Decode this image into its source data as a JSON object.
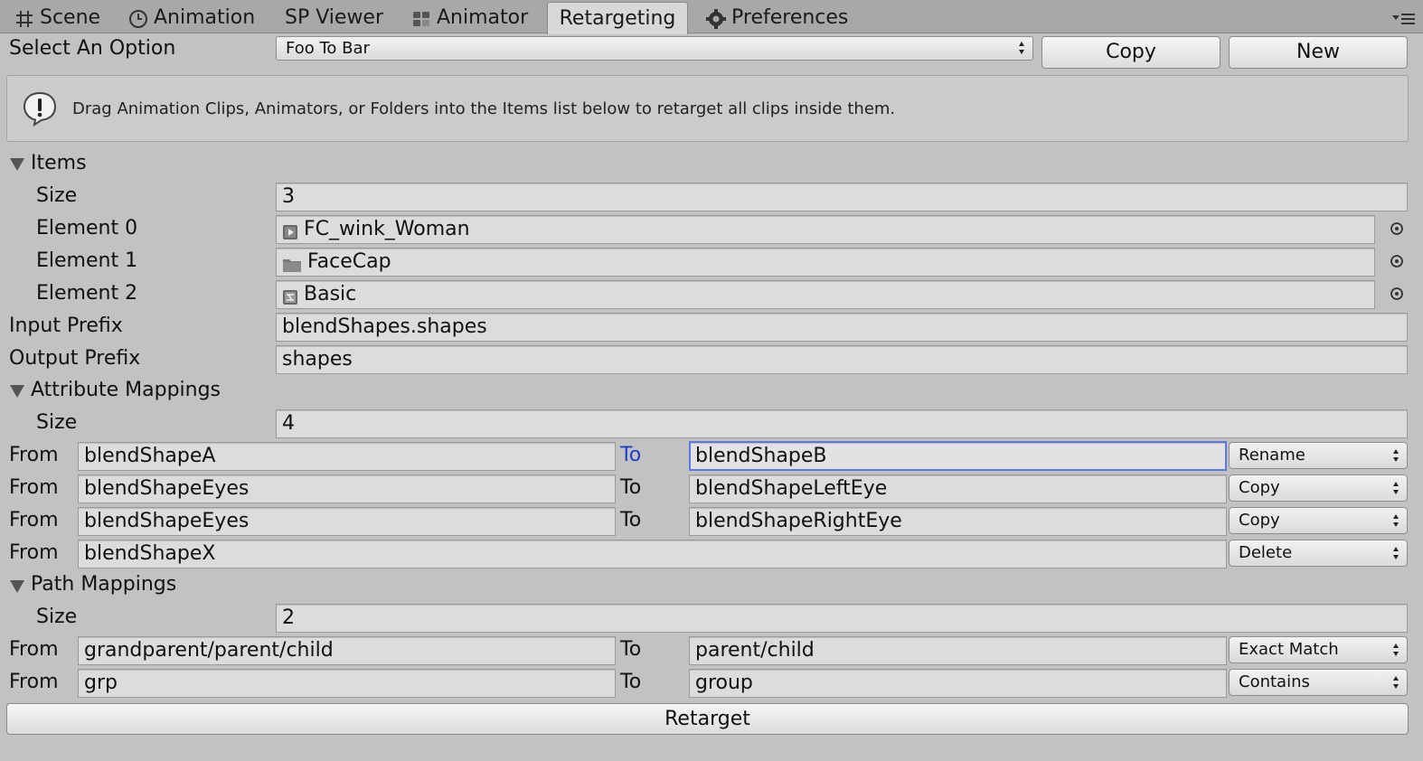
{
  "tabs": [
    {
      "label": "Scene",
      "icon": "grid-icon"
    },
    {
      "label": "Animation",
      "icon": "clock-icon"
    },
    {
      "label": "SP Viewer",
      "icon": ""
    },
    {
      "label": "Animator",
      "icon": "animator-icon"
    },
    {
      "label": "Retargeting",
      "icon": "",
      "active": true
    },
    {
      "label": "Preferences",
      "icon": "gear-icon"
    }
  ],
  "select": {
    "label": "Select An Option",
    "value": "Foo To Bar",
    "copy_label": "Copy",
    "new_label": "New"
  },
  "help": {
    "icon": "info-icon",
    "text": "Drag Animation Clips, Animators, or Folders into the Items list below to retarget all clips inside them."
  },
  "items": {
    "title": "Items",
    "size_label": "Size",
    "size": "3",
    "elements": [
      {
        "label": "Element 0",
        "value": "FC_wink_Woman",
        "icon": "animation-clip-icon"
      },
      {
        "label": "Element 1",
        "value": "FaceCap",
        "icon": "folder-icon"
      },
      {
        "label": "Element 2",
        "value": "Basic",
        "icon": "animator-controller-icon"
      }
    ]
  },
  "input_prefix": {
    "label": "Input Prefix",
    "value": "blendShapes.shapes"
  },
  "output_prefix": {
    "label": "Output Prefix",
    "value": "shapes"
  },
  "attribute_mappings": {
    "title": "Attribute Mappings",
    "size_label": "Size",
    "size": "4",
    "rows": [
      {
        "from_label": "From",
        "from": "blendShapeA",
        "to_label": "To",
        "to": "blendShapeB",
        "mode": "Rename"
      },
      {
        "from_label": "From",
        "from": "blendShapeEyes",
        "to_label": "To",
        "to": "blendShapeLeftEye",
        "mode": "Copy"
      },
      {
        "from_label": "From",
        "from": "blendShapeEyes",
        "to_label": "To",
        "to": "blendShapeRightEye",
        "mode": "Copy"
      },
      {
        "from_label": "From",
        "from": "blendShapeX",
        "mode": "Delete"
      }
    ]
  },
  "path_mappings": {
    "title": "Path Mappings",
    "size_label": "Size",
    "size": "2",
    "rows": [
      {
        "from_label": "From",
        "from": "grandparent/parent/child",
        "to_label": "To",
        "to": "parent/child",
        "mode": "Exact Match"
      },
      {
        "from_label": "From",
        "from": "grp",
        "to_label": "To",
        "to": "group",
        "mode": "Contains"
      }
    ]
  },
  "retarget_label": "Retarget",
  "colors": {
    "background": "#c2c2c2",
    "tabbar": "#a8a8a8",
    "focus_border": "#5b7be0",
    "active_label": "#1f3fc8"
  }
}
